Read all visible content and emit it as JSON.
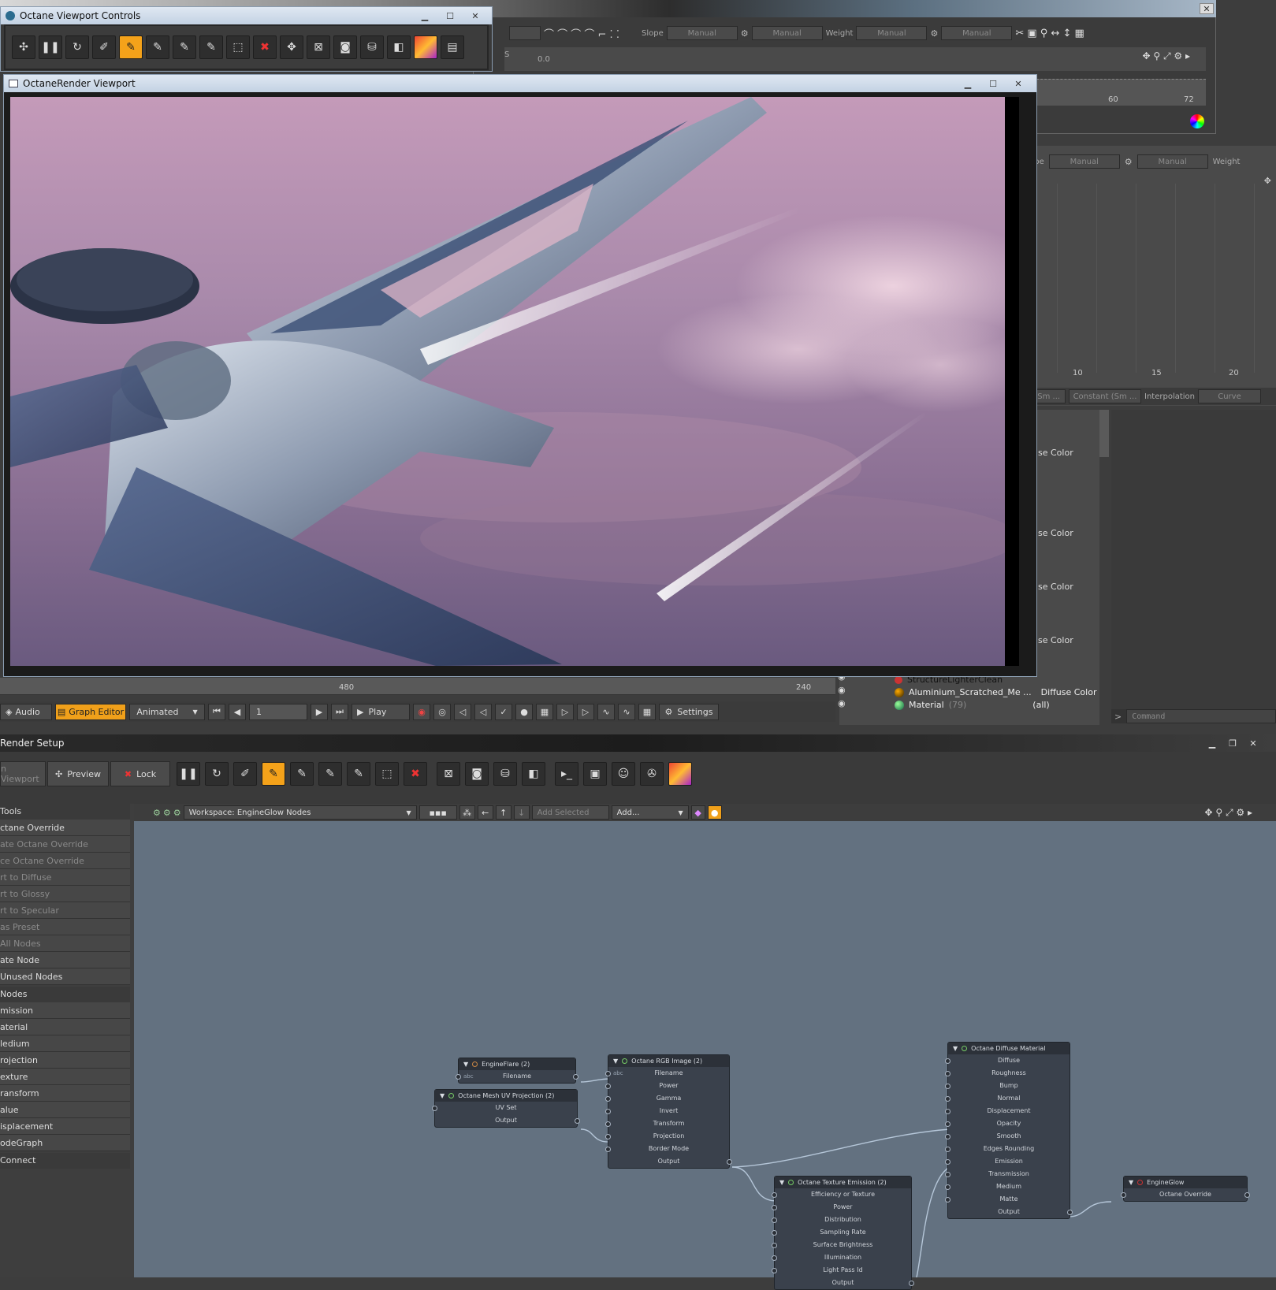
{
  "top_right_panel": {
    "slope_label": "Slope",
    "weight_label": "Weight",
    "manual": "Manual",
    "ruler_a": "60",
    "ruler_b": "72",
    "field_value": "0.0",
    "s_btn": "S",
    "slope_label2": "Slope",
    "weight_label2": "Weight",
    "ruler2_a": "10",
    "ruler2_b": "15",
    "ruler2_c": "20",
    "interp_a": "nt (Sm ...",
    "interp_b": "Constant (Sm ...",
    "interp_label": "Interpolation",
    "curve": "Curve",
    "color_items": [
      "se Color",
      "se Color",
      "se Color",
      "se Color"
    ]
  },
  "viewport_controls": {
    "title": "Octane Viewport Controls"
  },
  "render_viewport": {
    "title": "OctaneRender Viewport"
  },
  "timeline": {
    "marks": [
      "480",
      "240"
    ]
  },
  "scene_list": {
    "items": [
      {
        "name": "StructureLighterClean",
        "type": ""
      },
      {
        "name": "Aluminium_Scratched_Me ...",
        "type": "Diffuse Color"
      },
      {
        "name": "Material",
        "count": "(79)",
        "type": "(all)"
      }
    ]
  },
  "playback": {
    "audio": "Audio",
    "graph_editor": "Graph Editor",
    "animated": "Animated",
    "frame": "1",
    "play": "Play",
    "settings": "Settings",
    "command": "Command"
  },
  "render_setup": {
    "title": "Render Setup",
    "viewport_btn": "n Viewport",
    "preview": "Preview",
    "lock": "Lock",
    "workspace": "Workspace: EngineGlow Nodes",
    "add_selected": "Add Selected",
    "add": "Add..."
  },
  "sidebar": {
    "tools_header": "Tools",
    "tools": [
      {
        "label": "ctane Override",
        "dim": false
      },
      {
        "label": "ate Octane Override",
        "dim": true
      },
      {
        "label": "ce Octane Override",
        "dim": true
      },
      {
        "label": "rt to Diffuse",
        "dim": true
      },
      {
        "label": "rt to Glossy",
        "dim": true
      },
      {
        "label": "rt to Specular",
        "dim": true
      },
      {
        "label": "as Preset",
        "dim": true
      },
      {
        "label": "All Nodes",
        "dim": true
      },
      {
        "label": "ate Node",
        "dim": false
      },
      {
        "label": "Unused Nodes",
        "dim": false
      }
    ],
    "nodes_header": "Nodes",
    "nodes": [
      "mission",
      "aterial",
      "ledium",
      "rojection",
      "exture",
      "ransform",
      "alue",
      "isplacement",
      "odeGraph"
    ],
    "connect": "Connect"
  },
  "nodes": {
    "engineflare": {
      "title": "EngineFlare (2)",
      "abc": "abc",
      "rows": [
        "Filename"
      ]
    },
    "uvproj": {
      "title": "Octane Mesh UV Projection (2)",
      "rows": [
        "UV Set",
        "Output"
      ]
    },
    "rgbimage": {
      "title": "Octane RGB Image (2)",
      "abc": "abc",
      "rows": [
        "Filename",
        "Power",
        "Gamma",
        "Invert",
        "Transform",
        "Projection",
        "Border Mode",
        "Output"
      ]
    },
    "emission": {
      "title": "Octane Texture Emission (2)",
      "rows": [
        "Efficiency or Texture",
        "Power",
        "Distribution",
        "Sampling Rate",
        "Surface Brightness",
        "Illumination",
        "Light Pass Id",
        "Output"
      ]
    },
    "diffuse": {
      "title": "Octane Diffuse Material",
      "rows": [
        "Diffuse",
        "Roughness",
        "Bump",
        "Normal",
        "Displacement",
        "Opacity",
        "Smooth",
        "Edges Rounding",
        "Emission",
        "Transmission",
        "Medium",
        "Matte",
        "Output"
      ]
    },
    "engineglow": {
      "title": "EngineGlow",
      "rows": [
        "Octane Override"
      ]
    }
  }
}
